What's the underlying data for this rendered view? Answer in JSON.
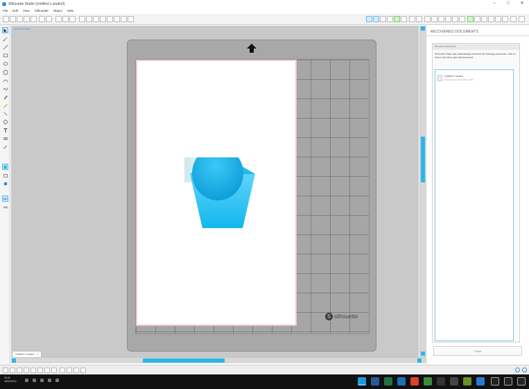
{
  "window": {
    "title": "Silhouette Studio (Untitled-1.studio3)",
    "minimize": "–",
    "maximize": "□",
    "close": "✕"
  },
  "menu": [
    "File",
    "Edit",
    "View",
    "Silhouette",
    "Object",
    "Help"
  ],
  "canvas": {
    "document_label": "DESIGN PAGE",
    "mat_brand": "silhouette",
    "mat_logo_letter": "S"
  },
  "document_tab": {
    "label": "Untitled-1.studio3",
    "close": "x"
  },
  "recovered_panel": {
    "title": "RECOVERED DOCUMENTS",
    "section_header": "Recover Document",
    "message": "Silhouette Studio has automatically recovered the following documents. Click on them in the list to open that document.",
    "file_name": "Untitled-1.studio3",
    "file_meta": "Recovered April 18 2016 14:35",
    "close_label": "Close"
  },
  "taskbar": {
    "time": "15:43",
    "date": "18/04/2016"
  },
  "colors": {
    "accent": "#2bb6e8",
    "shape": "#1dbff0"
  }
}
